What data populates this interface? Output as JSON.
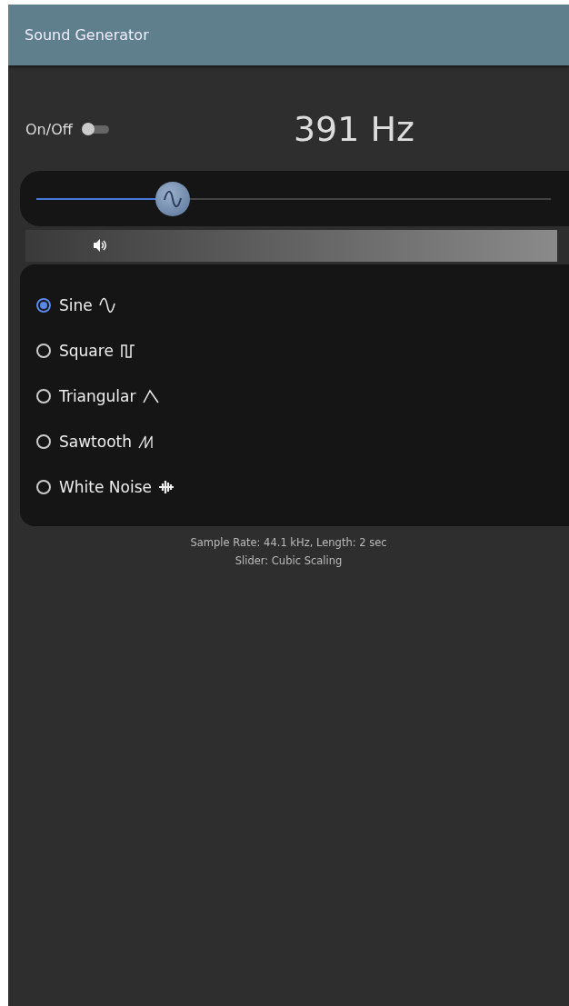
{
  "window": {
    "title": "Sound Generator"
  },
  "power": {
    "label": "On/Off",
    "on": false
  },
  "frequency": {
    "reading": "391 Hz",
    "level": 0.265
  },
  "volume": {
    "level": 0.14
  },
  "waveforms": [
    {
      "label": "Sine",
      "kind": "sine",
      "selected": true
    },
    {
      "label": "Square",
      "kind": "square",
      "selected": false
    },
    {
      "label": "Triangular",
      "kind": "triangle",
      "selected": false
    },
    {
      "label": "Sawtooth",
      "kind": "sawtooth",
      "selected": false
    },
    {
      "label": "White Noise",
      "kind": "noise",
      "selected": false
    }
  ],
  "footer": [
    "Sample Rate: 44.1 kHz, Length: 2 sec",
    "Slider: Cubic Scaling"
  ]
}
